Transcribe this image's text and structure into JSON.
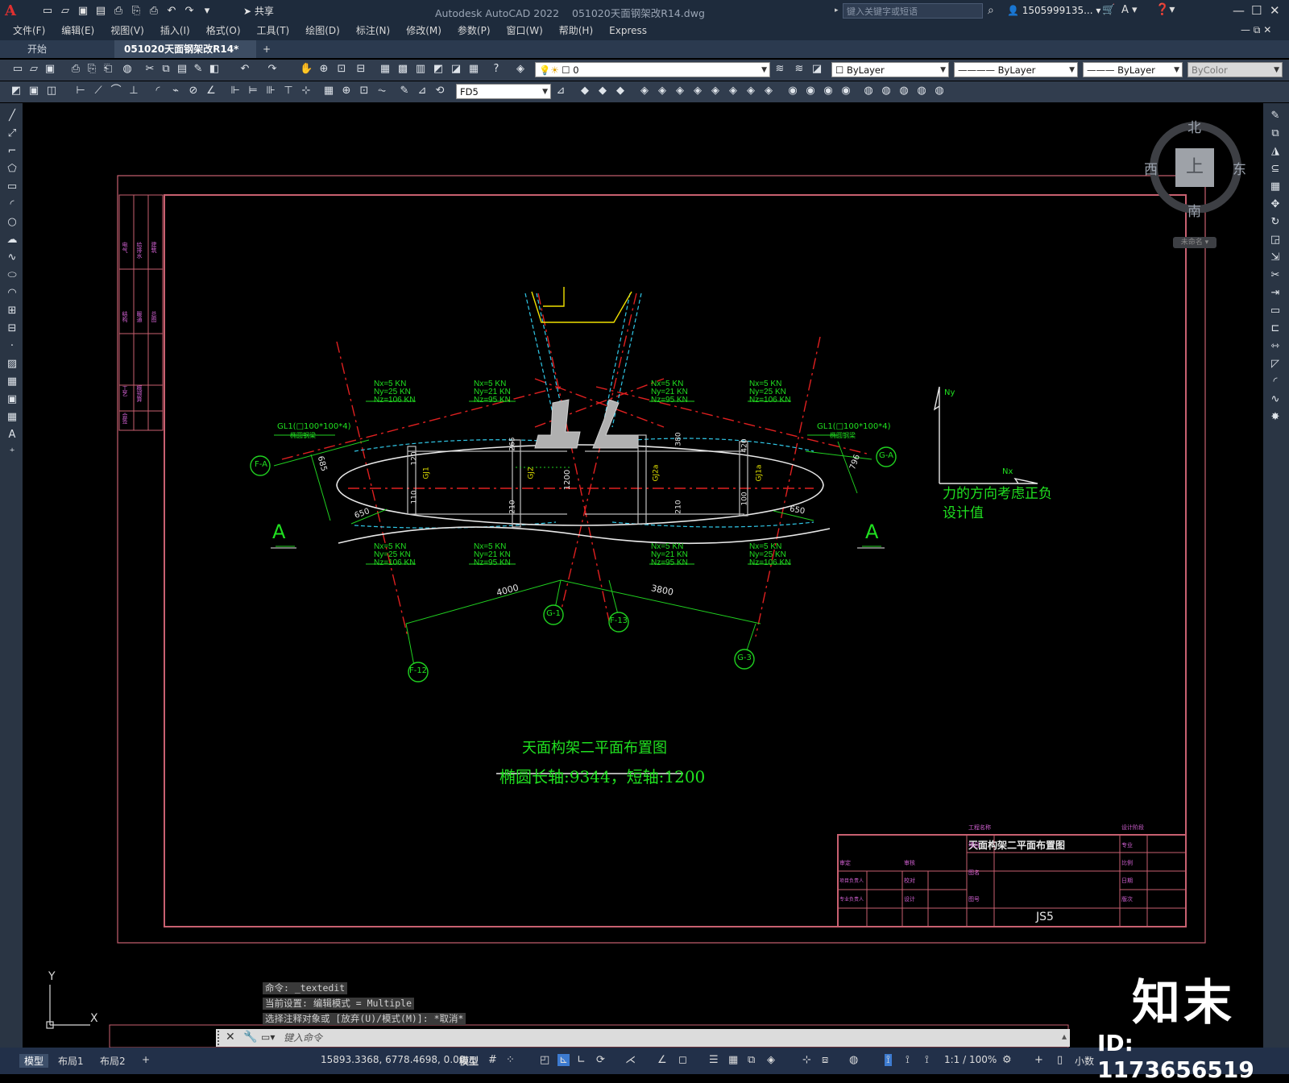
{
  "app": {
    "title": "Autodesk AutoCAD 2022",
    "file": "051020天面钢架改R14.dwg",
    "share": "共享",
    "search_placeholder": "键入关键字或短语",
    "user": "1505999135...",
    "logo": "A"
  },
  "menu": [
    "文件(F)",
    "编辑(E)",
    "视图(V)",
    "插入(I)",
    "格式(O)",
    "工具(T)",
    "绘图(D)",
    "标注(N)",
    "修改(M)",
    "参数(P)",
    "窗口(W)",
    "帮助(H)",
    "Express"
  ],
  "tabs": [
    {
      "label": "开始",
      "active": false
    },
    {
      "label": "051020天面钢架改R14*",
      "active": true
    },
    {
      "label": "+",
      "active": false
    }
  ],
  "toolbar": {
    "layer": "0",
    "color": "ByLayer",
    "linetype": "ByLayer",
    "lineweight": "ByLayer",
    "plotstyle": "ByColor",
    "dimstyle": "FD5"
  },
  "compass": {
    "north": "北",
    "south": "南",
    "east": "东",
    "west": "西",
    "top": "上",
    "ucs": "未命名"
  },
  "drawing": {
    "loads": [
      [
        "Nx=5 KN",
        "Ny=25 KN",
        "Nz=106 KN"
      ],
      [
        "Nx=5 KN",
        "Ny=21 KN",
        "Nz=95 KN"
      ],
      [
        "Nx=5 KN",
        "Ny=21 KN",
        "Nz=95 KN"
      ],
      [
        "Nx=5 KN",
        "Ny=25 KN",
        "Nz=106 KN"
      ],
      [
        "Nx=5 KN",
        "Ny=25 KN",
        "Nz=106 KN"
      ],
      [
        "Nx=5 KN",
        "Ny=21 KN",
        "Nz=95 KN"
      ],
      [
        "Nx=5 KN",
        "Ny=21 KN",
        "Nz=95 KN"
      ],
      [
        "Nx=5 KN",
        "Ny=25 KN",
        "Nz=106 KN"
      ]
    ],
    "gl_left": "GL1(□100*100*4)",
    "gl_right": "GL1(□100*100*4)",
    "gl_sub": "椭圆钢梁",
    "axes": [
      "F-A",
      "G-A",
      "G-1",
      "F-13",
      "F-12",
      "G-3"
    ],
    "section_mark": "A",
    "dims": [
      "685",
      "796",
      "650",
      "650",
      "4000",
      "3800",
      "1200",
      "120",
      "110",
      "265",
      "210",
      "380",
      "210",
      "420",
      "100"
    ],
    "beams": [
      "GJ1",
      "GJ2",
      "GJ2a",
      "GJ1a"
    ],
    "ny": "Ny",
    "nx": "Nx",
    "note1": "力的方向考虑正负",
    "note2": "设计值",
    "main_title": "天面构架二平面布置图",
    "sub_title": "椭圆长轴:9344，短轴:1200"
  },
  "titleblock": {
    "drawing_name": "天面构架二平面布置图",
    "drawing_no": "JS5",
    "cells": [
      "工程名称",
      "项目",
      "审定",
      "审核",
      "项目负责人",
      "校对",
      "专业负责人",
      "设计",
      "图名",
      "图号",
      "设计阶段",
      "专业",
      "比例",
      "日期",
      "版次"
    ]
  },
  "side_labels": [
    "电气",
    "给排水",
    "建筑",
    "结构",
    "暖通",
    "总图",
    "工艺",
    "概预算",
    "会签"
  ],
  "command": {
    "history": [
      "命令: _textedit",
      "当前设置: 编辑模式 = Multiple",
      "选择注释对象或 [放弃(U)/模式(M)]: *取消*"
    ],
    "placeholder": "键入命令"
  },
  "status": {
    "tabs": [
      "模型",
      "布局1",
      "布局2"
    ],
    "coords": "15893.3368, 6778.4698, 0.00...",
    "mode": "模型",
    "scale": "1:1 / 100%",
    "units": "小数"
  },
  "watermark": {
    "logo": "知末",
    "id": "ID: 1173656519"
  }
}
